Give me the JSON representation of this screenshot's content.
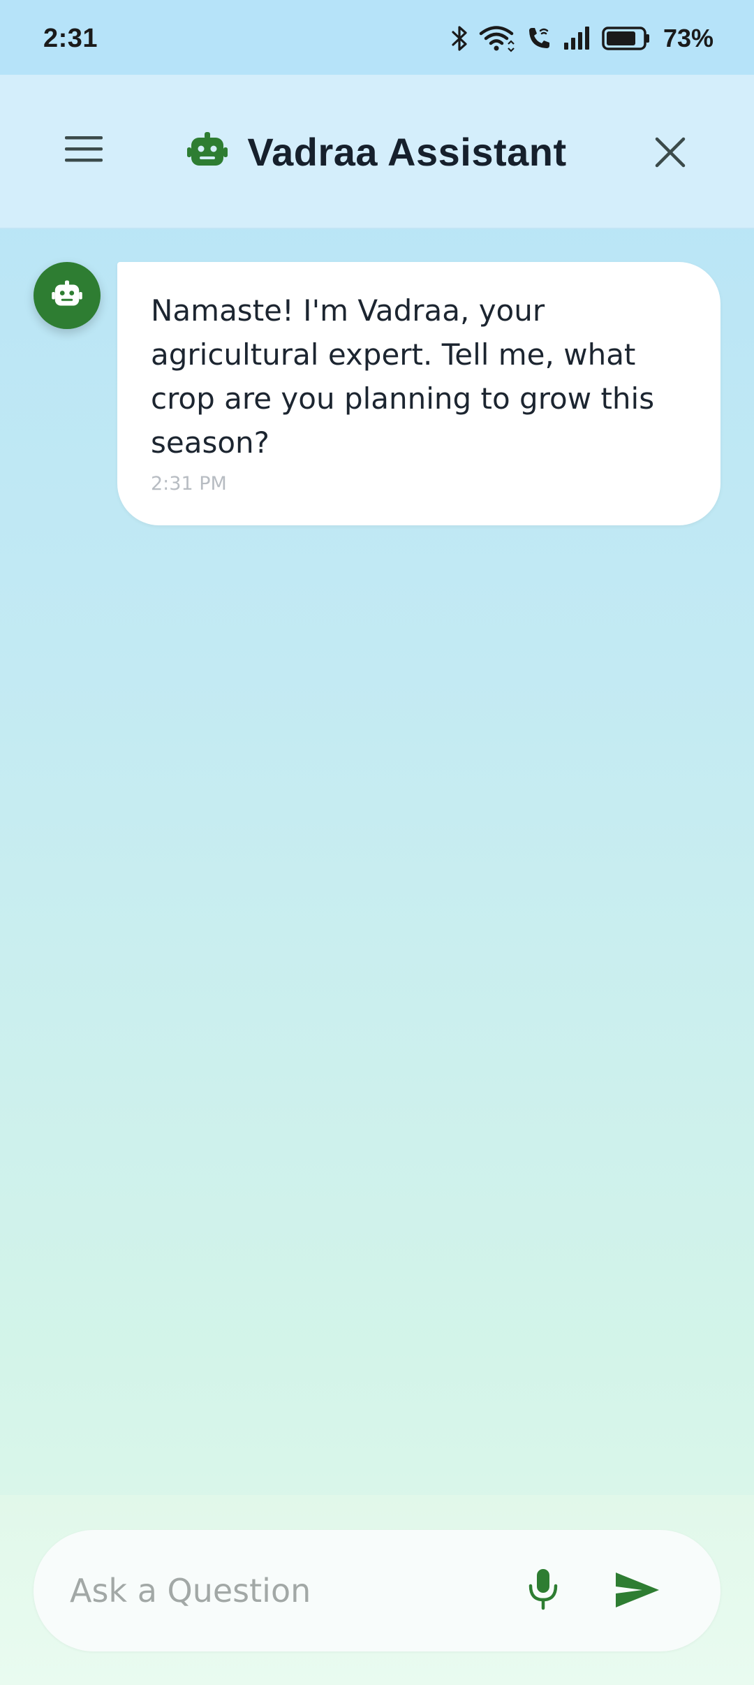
{
  "status_bar": {
    "time": "2:31",
    "battery_percent": "73%",
    "icons": [
      "bluetooth-icon",
      "wifi-icon",
      "wifi-calling-icon",
      "signal-icon",
      "battery-icon"
    ]
  },
  "header": {
    "title": "Vadraa Assistant",
    "icons": {
      "menu": "menu-icon",
      "bot": "robot-icon",
      "close": "close-icon"
    },
    "bot_color": "#2e7d32"
  },
  "chat": {
    "messages": [
      {
        "sender": "bot",
        "text": "Namaste! I'm Vadraa, your agricultural expert. Tell me, what crop are you planning to grow this season?",
        "time": "2:31 PM"
      }
    ]
  },
  "input": {
    "placeholder": "Ask a Question",
    "value": "",
    "icons": {
      "mic": "microphone-icon",
      "send": "send-icon"
    },
    "accent_color": "#2e7d32"
  }
}
